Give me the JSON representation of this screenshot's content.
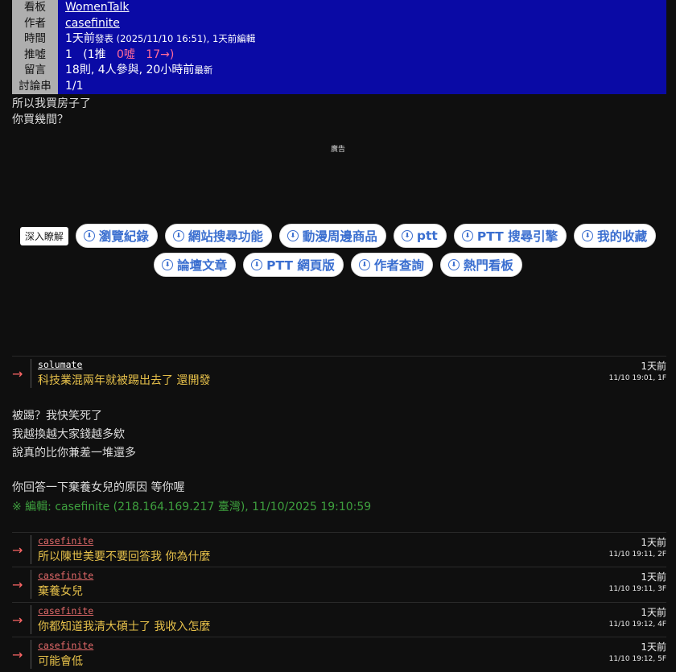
{
  "header": {
    "rows": [
      {
        "label": "看板",
        "value": "WomenTalk"
      },
      {
        "label": "作者",
        "value": "casefinite"
      },
      {
        "label": "時間",
        "v1": "1天前",
        "v2": "發表",
        "v3": " (2025/11/10 16:51), 1天前",
        "v4": "編輯"
      },
      {
        "label": "推噓",
        "v1": "1",
        "v2": "(1推",
        "v3": "0噓",
        "v4": "17→)"
      },
      {
        "label": "留言",
        "v1": "18則, 4人參與, 20小時前",
        "v2": "最新"
      },
      {
        "label": "討論串",
        "value": "1/1"
      }
    ]
  },
  "content": {
    "line1": "所以我買房子了",
    "line2": "你買幾間？",
    "ad_label": "廣告"
  },
  "chips": {
    "deep": "深入瞭解",
    "row1": [
      "瀏覽紀錄",
      "網站搜尋功能",
      "動漫周邊商品",
      "ptt",
      "PTT 搜尋引擎",
      "我的收藏"
    ],
    "row2": [
      "論壇文章",
      "PTT 網頁版",
      "作者查詢",
      "熱門看板"
    ]
  },
  "pushes": [
    {
      "user": "solumate",
      "msg": "科技業混兩年就被踢出去了 還開發",
      "ago": "1天前",
      "ts": "11/10 19:01, 1F"
    },
    {
      "user": "casefinite",
      "msg": "所以陳世美要不要回答我 你為什麼",
      "ago": "1天前",
      "ts": "11/10 19:11, 2F"
    },
    {
      "user": "casefinite",
      "msg": "棄養女兒",
      "ago": "1天前",
      "ts": "11/10 19:11, 3F"
    },
    {
      "user": "casefinite",
      "msg": "你都知道我清大碩士了 我收入怎麼",
      "ago": "1天前",
      "ts": "11/10 19:12, 4F"
    },
    {
      "user": "casefinite",
      "msg": "可能會低",
      "ago": "1天前",
      "ts": "11/10 19:12, 5F"
    }
  ],
  "reply": {
    "line1": "被踢？我快笑死了",
    "line2": "我越換越大家錢越多欸",
    "line3": "說真的比你兼差一堆還多",
    "line4": "你回答一下棄養女兒的原因 等你喔"
  },
  "edit_note": "※ 編輯: casefinite (218.164.169.217 臺灣), 11/10/2025 19:10:59",
  "arrow_symbol": "→",
  "icon_symbol": "⬇",
  "colors": {
    "header_bg": "#0a0aa5",
    "label_bg": "#aeaeae",
    "push_msg": "#e6c04a",
    "edit": "#3ea03e",
    "chip_text": "#3b6fd0"
  }
}
